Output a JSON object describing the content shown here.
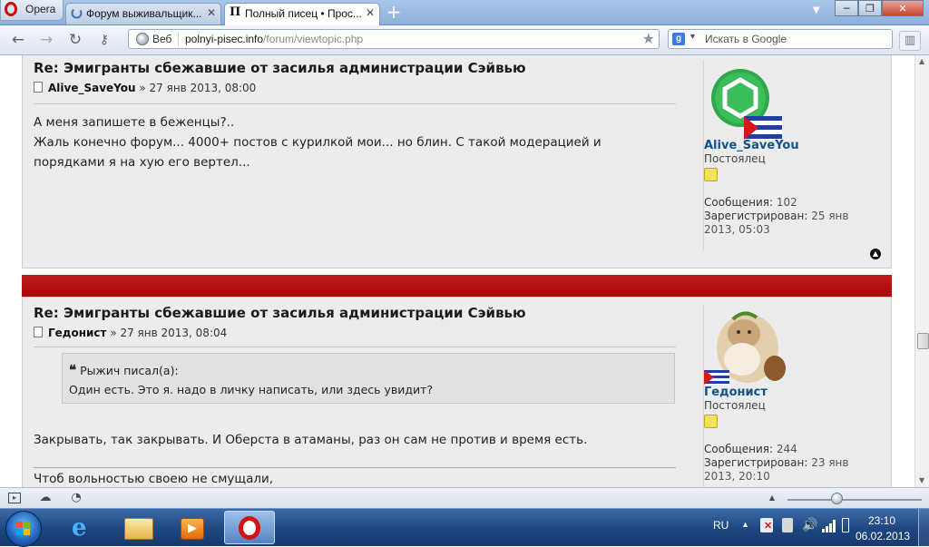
{
  "browser": {
    "opera_menu_label": "Opera",
    "tabs": [
      {
        "title": "Форум выживальщик...",
        "active": false
      },
      {
        "title": "Полный писец • Прос...",
        "active": true
      }
    ],
    "new_tab": "+",
    "window_controls": {
      "minimize": "─",
      "restore": "❐",
      "close": "✕"
    },
    "address": {
      "web_label": "Веб",
      "url_host": "polnyi-pisec.info",
      "url_path": "/forum/viewtopic.php"
    },
    "search": {
      "engine_icon": "g",
      "placeholder": "Искать в Google"
    }
  },
  "posts": [
    {
      "title": "Re: Эмигранты сбежавшие от засилья администрации Сэйвью",
      "author": "Alive_SaveYou",
      "date": " » 27 янв 2013, 08:00",
      "body": [
        "А меня запишете в беженцы?..",
        "Жаль конечно форум... 4000+ постов с курилкой мои... но блин. С такой модерацией и",
        "порядками я на хую его вертел..."
      ],
      "profile": {
        "name": "Alive_SaveYou",
        "rank": "Постоялец",
        "messages_label": "Сообщения:",
        "messages_value": " 102",
        "registered_label": "Зарегистрирован:",
        "registered_value_1": " 25 янв",
        "registered_value_2": "2013, 05:03"
      }
    },
    {
      "title": "Re: Эмигранты сбежавшие от засилья администрации Сэйвью",
      "author": "Гедонист",
      "date": " » 27 янв 2013, 08:04",
      "quote": {
        "header": "Рыжич писал(а):",
        "text": "Один есть. Это я. надо в личку написать, или здесь увидит?"
      },
      "body": [
        "Закрывать, так закрывать. И Оберста в атаманы, раз он сам не против и время есть."
      ],
      "signature": "Чтоб вольностью своею не смущали,",
      "profile": {
        "name": "Гедонист",
        "rank": "Постоялец",
        "messages_label": "Сообщения:",
        "messages_value": " 244",
        "registered_label": "Зарегистрирован:",
        "registered_value_1": " 23 янв",
        "registered_value_2": "2013, 20:10"
      }
    }
  ],
  "taskbar": {
    "language": "RU",
    "time": "23:10",
    "date": "06.02.2013"
  }
}
